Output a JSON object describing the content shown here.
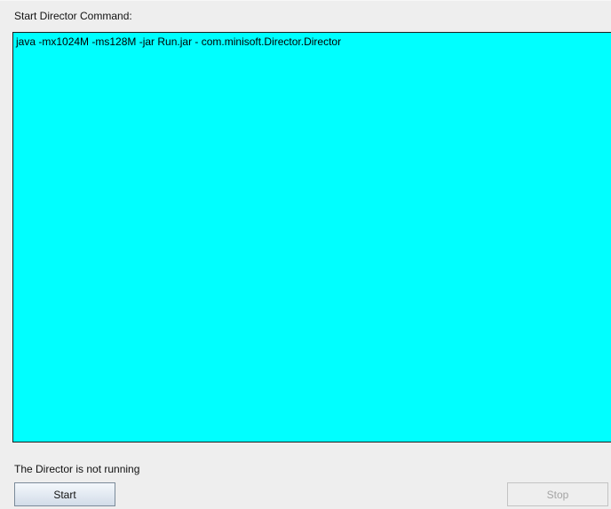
{
  "start_director": {
    "command_label": "Start Director Command:",
    "command_value": "java -mx1024M -ms128M -jar Run.jar - com.minisoft.Director.Director"
  },
  "status": {
    "text": "The Director is not running"
  },
  "buttons": {
    "start_label": "Start",
    "stop_label": "Stop",
    "stop_enabled": false
  },
  "colors": {
    "command_area_background": "#00ffff",
    "window_background": "#eeeeee"
  }
}
